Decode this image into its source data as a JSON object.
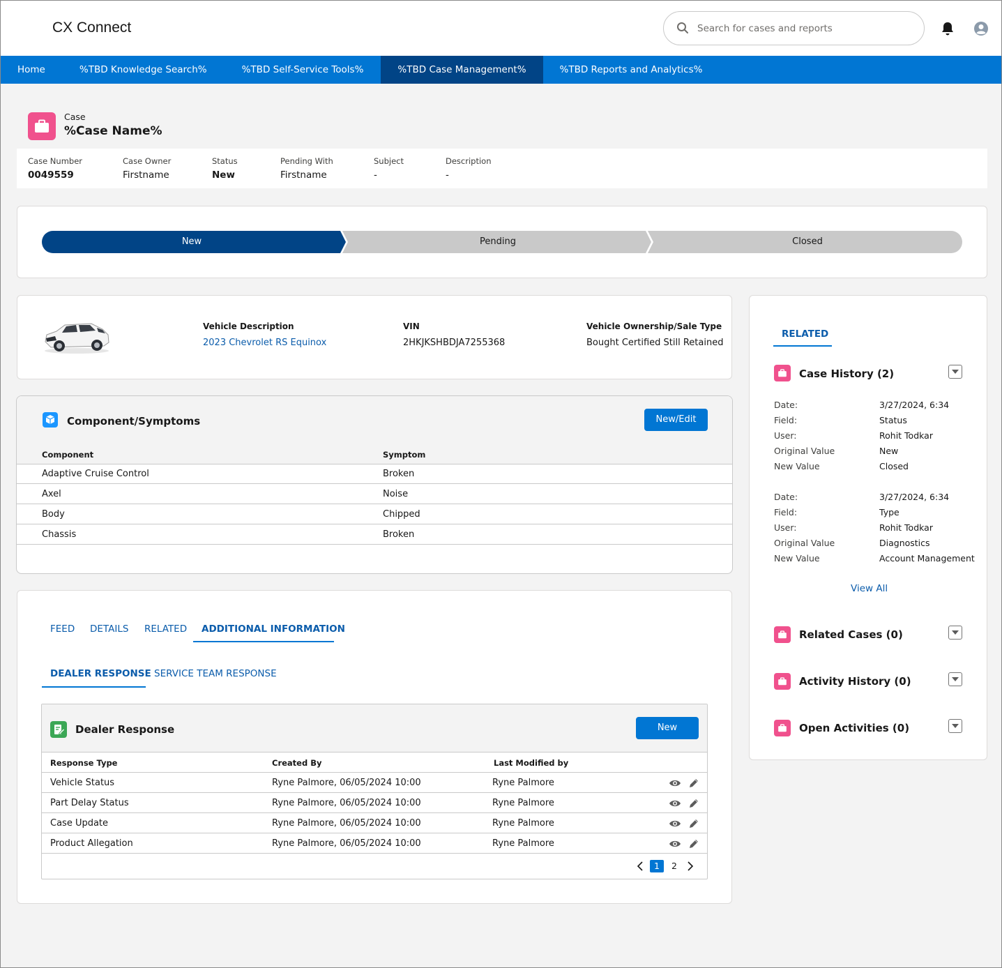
{
  "header": {
    "app_title": "CX Connect",
    "search_placeholder": "Search for cases and reports"
  },
  "nav": {
    "items": [
      {
        "label": "Home"
      },
      {
        "label": "%TBD Knowledge Search%"
      },
      {
        "label": "%TBD Self-Service Tools%"
      },
      {
        "label": "%TBD Case Management%"
      },
      {
        "label": "%TBD Reports and Analytics%"
      }
    ],
    "active_index": 3
  },
  "case": {
    "type_label": "Case",
    "name": "%Case Name%",
    "fields": [
      {
        "label": "Case Number",
        "value": "0049559"
      },
      {
        "label": "Case Owner",
        "value": "Firstname"
      },
      {
        "label": "Status",
        "value": "New"
      },
      {
        "label": "Pending With",
        "value": "Firstname"
      },
      {
        "label": "Subject",
        "value": "-"
      },
      {
        "label": "Description",
        "value": "-"
      }
    ]
  },
  "path": {
    "steps": [
      "New",
      "Pending",
      "Closed"
    ],
    "current_index": 0
  },
  "vehicle": {
    "description_label": "Vehicle Description",
    "description_value": "2023 Chevrolet RS Equinox",
    "vin_label": "VIN",
    "vin_value": "2HKJKSHBDJA7255368",
    "ownership_label": "Vehicle Ownership/Sale Type",
    "ownership_value": "Bought Certified Still Retained"
  },
  "components": {
    "title": "Component/Symptoms",
    "button_label": "New/Edit",
    "columns": [
      "Component",
      "Symptom"
    ],
    "rows": [
      [
        "Adaptive Cruise Control",
        "Broken"
      ],
      [
        "Axel",
        "Noise"
      ],
      [
        "Body",
        "Chipped"
      ],
      [
        "Chassis",
        "Broken"
      ]
    ]
  },
  "tabs": {
    "primary": [
      "FEED",
      "DETAILS",
      "RELATED",
      "ADDITIONAL INFORMATION"
    ],
    "primary_active": 3,
    "secondary": [
      "DEALER RESPONSE",
      "SERVICE TEAM RESPONSE"
    ],
    "secondary_active": 0
  },
  "dealer_response": {
    "title": "Dealer Response",
    "button_label": "New",
    "columns": [
      "Response Type",
      "Created By",
      "Last Modified by"
    ],
    "rows": [
      [
        "Vehicle Status",
        "Ryne Palmore, 06/05/2024 10:00",
        "Ryne Palmore"
      ],
      [
        "Part Delay Status",
        "Ryne Palmore, 06/05/2024 10:00",
        "Ryne Palmore"
      ],
      [
        "Case Update",
        "Ryne Palmore, 06/05/2024 10:00",
        "Ryne Palmore"
      ],
      [
        "Product Allegation",
        "Ryne Palmore, 06/05/2024 10:00",
        "Ryne Palmore"
      ]
    ],
    "pagination": {
      "pages": [
        "1",
        "2"
      ],
      "current": "1"
    }
  },
  "related": {
    "tab_label": "RELATED",
    "case_history": {
      "title": "Case History (2)",
      "entries": [
        {
          "date_label": "Date:",
          "date": "3/27/2024, 6:34",
          "field_label": "Field:",
          "field": "Status",
          "user_label": "User:",
          "user": "Rohit Todkar",
          "orig_label": "Original Value",
          "orig": "New",
          "new_label": "New Value",
          "new": "Closed"
        },
        {
          "date_label": "Date:",
          "date": "3/27/2024, 6:34",
          "field_label": "Field:",
          "field": "Type",
          "user_label": "User:",
          "user": "Rohit Todkar",
          "orig_label": "Original Value",
          "orig": "Diagnostics",
          "new_label": "New Value",
          "new": "Account Management"
        }
      ],
      "view_all": "View All"
    },
    "related_cases": "Related Cases (0)",
    "activity_history": "Activity History (0)",
    "open_activities": "Open Activities (0)"
  },
  "colors": {
    "brand": "#0176d3",
    "brand_dark": "#014486",
    "case_icon": "#f0518d",
    "path_incomplete": "#c9c9c9",
    "link": "#0b5cab"
  },
  "icons": [
    "search-icon",
    "bell-icon",
    "user-avatar-icon",
    "briefcase-icon",
    "cube-icon",
    "document-edit-icon",
    "eye-icon",
    "pencil-icon",
    "chevron-left-icon",
    "chevron-right-icon",
    "chevron-down-icon"
  ]
}
